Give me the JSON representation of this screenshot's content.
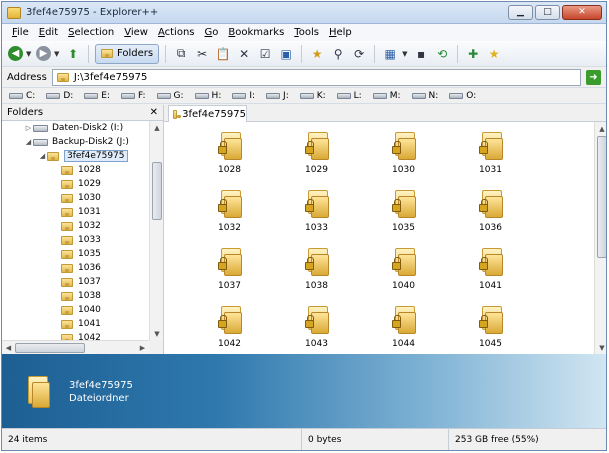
{
  "window": {
    "title": "3fef4e75975 - Explorer++"
  },
  "menu": [
    "File",
    "Edit",
    "Selection",
    "View",
    "Actions",
    "Go",
    "Bookmarks",
    "Tools",
    "Help"
  ],
  "toolbar": {
    "folders_label": "Folders"
  },
  "address": {
    "label": "Address",
    "value": "J:\\3fef4e75975"
  },
  "drives": [
    "C:",
    "D:",
    "E:",
    "F:",
    "G:",
    "H:",
    "I:",
    "J:",
    "K:",
    "L:",
    "M:",
    "N:",
    "O:"
  ],
  "folders_pane": {
    "title": "Folders",
    "tree": [
      {
        "label": "Daten-Disk2 (I:)",
        "level": 1,
        "kind": "drive",
        "expander": "collapsed"
      },
      {
        "label": "Backup-Disk2 (J:)",
        "level": 1,
        "kind": "drive",
        "expander": "expanded"
      },
      {
        "label": "3fef4e75975",
        "level": 2,
        "kind": "folder",
        "expander": "expanded",
        "selected": true
      },
      {
        "label": "1028",
        "level": 3,
        "kind": "folder"
      },
      {
        "label": "1029",
        "level": 3,
        "kind": "folder"
      },
      {
        "label": "1030",
        "level": 3,
        "kind": "folder"
      },
      {
        "label": "1031",
        "level": 3,
        "kind": "folder"
      },
      {
        "label": "1032",
        "level": 3,
        "kind": "folder"
      },
      {
        "label": "1033",
        "level": 3,
        "kind": "folder"
      },
      {
        "label": "1035",
        "level": 3,
        "kind": "folder"
      },
      {
        "label": "1036",
        "level": 3,
        "kind": "folder"
      },
      {
        "label": "1037",
        "level": 3,
        "kind": "folder"
      },
      {
        "label": "1038",
        "level": 3,
        "kind": "folder"
      },
      {
        "label": "1040",
        "level": 3,
        "kind": "folder"
      },
      {
        "label": "1041",
        "level": 3,
        "kind": "folder"
      },
      {
        "label": "1042",
        "level": 3,
        "kind": "folder"
      }
    ]
  },
  "tab": {
    "label": "3fef4e75975"
  },
  "items": [
    "1028",
    "1029",
    "1030",
    "1031",
    "1032",
    "1033",
    "1035",
    "1036",
    "1037",
    "1038",
    "1040",
    "1041",
    "1042",
    "1043",
    "1044",
    "1045",
    "",
    "",
    "",
    ""
  ],
  "details": {
    "name": "3fef4e75975",
    "type": "Dateiordner"
  },
  "status": {
    "items": "24 items",
    "size": "0 bytes",
    "free": "253 GB free (55%)"
  }
}
